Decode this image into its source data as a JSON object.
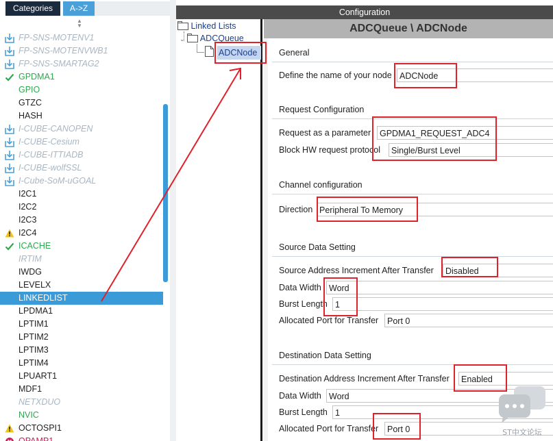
{
  "tabs": {
    "categories": "Categories",
    "az": "A->Z"
  },
  "sidebar": {
    "items": [
      {
        "label": "FP-SNS-MOTENV1",
        "kind": "pack",
        "icon": "download-icon"
      },
      {
        "label": "FP-SNS-MOTENVWB1",
        "kind": "pack",
        "icon": "download-icon"
      },
      {
        "label": "FP-SNS-SMARTAG2",
        "kind": "pack",
        "icon": "download-icon"
      },
      {
        "label": "GPDMA1",
        "kind": "green",
        "icon": "check-icon"
      },
      {
        "label": "GPIO",
        "kind": "green",
        "icon": ""
      },
      {
        "label": "GTZC",
        "kind": "normal",
        "icon": ""
      },
      {
        "label": "HASH",
        "kind": "normal",
        "icon": ""
      },
      {
        "label": "I-CUBE-CANOPEN",
        "kind": "pack",
        "icon": "download-icon"
      },
      {
        "label": "I-CUBE-Cesium",
        "kind": "pack",
        "icon": "download-icon"
      },
      {
        "label": "I-CUBE-ITTIADB",
        "kind": "pack",
        "icon": "download-icon"
      },
      {
        "label": "I-CUBE-wolfSSL",
        "kind": "pack",
        "icon": "download-icon"
      },
      {
        "label": "I-Cube-SoM-uGOAL",
        "kind": "pack",
        "icon": "download-icon"
      },
      {
        "label": "I2C1",
        "kind": "normal",
        "icon": ""
      },
      {
        "label": "I2C2",
        "kind": "normal",
        "icon": ""
      },
      {
        "label": "I2C3",
        "kind": "normal",
        "icon": ""
      },
      {
        "label": "I2C4",
        "kind": "normal",
        "icon": "warning-icon"
      },
      {
        "label": "ICACHE",
        "kind": "green",
        "icon": "check-icon"
      },
      {
        "label": "IRTIM",
        "kind": "dim",
        "icon": ""
      },
      {
        "label": "IWDG",
        "kind": "normal",
        "icon": ""
      },
      {
        "label": "LEVELX",
        "kind": "normal",
        "icon": ""
      },
      {
        "label": "LINKEDLIST",
        "kind": "sel",
        "icon": ""
      },
      {
        "label": "LPDMA1",
        "kind": "normal",
        "icon": ""
      },
      {
        "label": "LPTIM1",
        "kind": "normal",
        "icon": ""
      },
      {
        "label": "LPTIM2",
        "kind": "normal",
        "icon": ""
      },
      {
        "label": "LPTIM3",
        "kind": "normal",
        "icon": ""
      },
      {
        "label": "LPTIM4",
        "kind": "normal",
        "icon": ""
      },
      {
        "label": "LPUART1",
        "kind": "normal",
        "icon": ""
      },
      {
        "label": "MDF1",
        "kind": "normal",
        "icon": ""
      },
      {
        "label": "NETXDUO",
        "kind": "dim",
        "icon": ""
      },
      {
        "label": "NVIC",
        "kind": "green",
        "icon": ""
      },
      {
        "label": "OCTOSPI1",
        "kind": "normal",
        "icon": "warning-icon"
      },
      {
        "label": "OPAMP1",
        "kind": "pink",
        "icon": "error-icon"
      }
    ]
  },
  "config": {
    "title": "Configuration",
    "tree": {
      "root": "Linked Lists",
      "queue": "ADCQueue",
      "node": "ADCNode"
    },
    "panel_title": "ADCQueue \\ ADCNode",
    "general": {
      "heading": "General",
      "name_label": "Define the name of your node",
      "name_value": "ADCNode"
    },
    "request": {
      "heading": "Request Configuration",
      "param_label": "Request as a parameter",
      "param_value": "GPDMA1_REQUEST_ADC4",
      "block_label": "Block HW request protocol",
      "block_value": "Single/Burst Level"
    },
    "channel": {
      "heading": "Channel configuration",
      "dir_label": "Direction",
      "dir_value": "Peripheral To Memory"
    },
    "source": {
      "heading": "Source Data Setting",
      "inc_label": "Source Address Increment After Transfer",
      "inc_value": "Disabled",
      "width_label": "Data Width",
      "width_value": "Word",
      "burst_label": "Burst Length",
      "burst_value": "1",
      "port_label": "Allocated Port for Transfer",
      "port_value": "Port 0"
    },
    "dest": {
      "heading": "Destination Data Setting",
      "inc_label": "Destination Address Increment After Transfer",
      "inc_value": "Enabled",
      "width_label": "Data Width",
      "width_value": "Word",
      "burst_label": "Burst Length",
      "burst_value": "1",
      "port_label": "Allocated Port for Transfer",
      "port_value": "Port 0"
    }
  },
  "watermark": {
    "text": "ST中文论坛"
  },
  "colors": {
    "accent": "#3a9bd8",
    "annotation": "#e0202a",
    "ok": "#2ea84f"
  }
}
